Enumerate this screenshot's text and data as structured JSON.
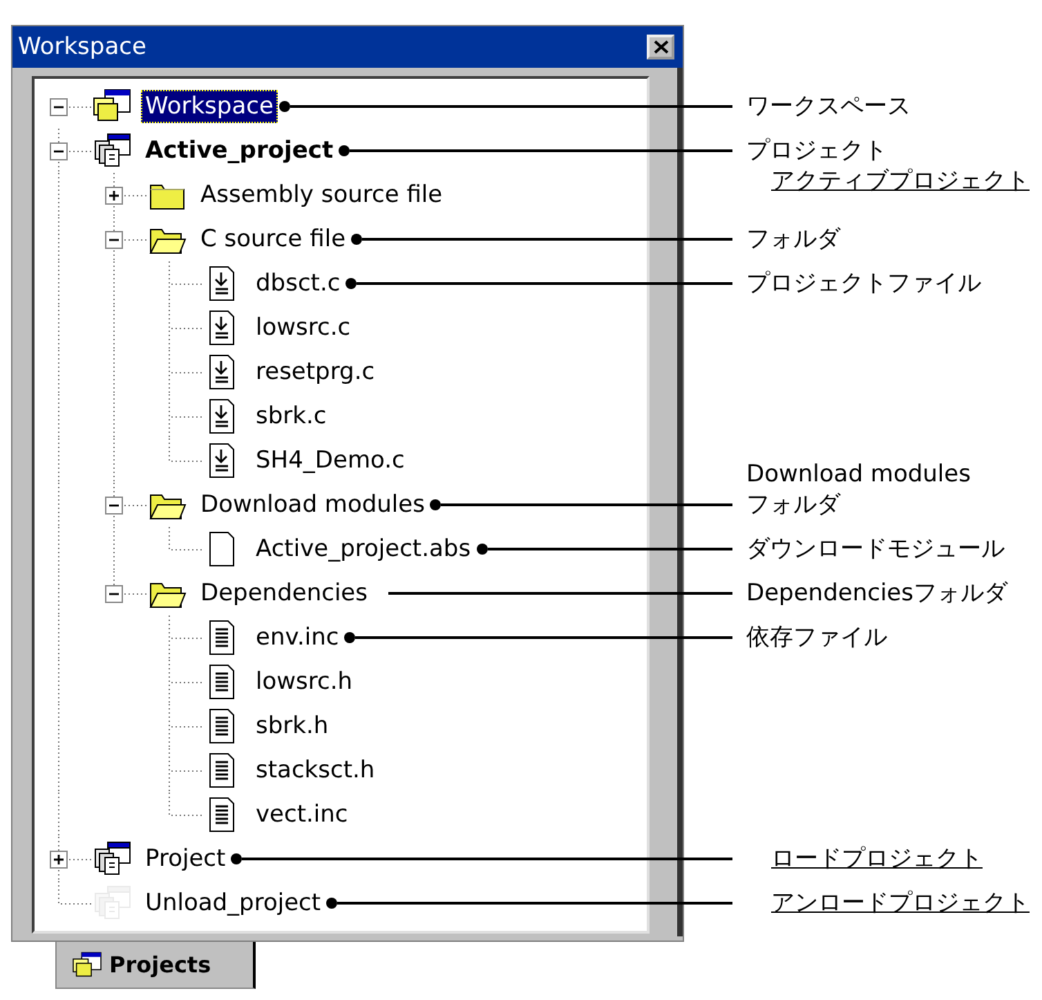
{
  "window": {
    "title": "Workspace"
  },
  "tree": [
    {
      "label": "Workspace",
      "kind": "workspace",
      "selected": true,
      "active": false,
      "disabled": false,
      "expanded": true,
      "callout": {
        "dot": true,
        "lines": [
          {
            "text": "ワークスペース",
            "underlined": false
          }
        ]
      },
      "children": [
        {
          "label": "Active_project",
          "kind": "project",
          "selected": false,
          "active": true,
          "disabled": false,
          "expanded": true,
          "callout": {
            "kind": "label-below",
            "dot": true,
            "lines": [
              {
                "text": "プロジェクト",
                "underlined": false
              },
              {
                "text": "アクティブプロジェクト",
                "underlined": true
              }
            ]
          },
          "children": [
            {
              "label": "Assembly source file",
              "kind": "folder",
              "selected": false,
              "active": false,
              "disabled": false,
              "expanded": false
            },
            {
              "label": "C source file",
              "kind": "folder-open",
              "selected": false,
              "active": false,
              "disabled": false,
              "expanded": true,
              "callout": {
                "dot": true,
                "lines": [
                  {
                    "text": "フォルダ",
                    "underlined": false
                  }
                ]
              },
              "children": [
                {
                  "label": "dbsct.c",
                  "kind": "download-file",
                  "selected": false,
                  "active": false,
                  "disabled": false,
                  "callout": {
                    "dot": true,
                    "lines": [
                      {
                        "text": "プロジェクトファイル",
                        "underlined": false
                      }
                    ]
                  }
                },
                {
                  "label": "lowsrc.c",
                  "kind": "download-file",
                  "selected": false,
                  "active": false,
                  "disabled": false
                },
                {
                  "label": "resetprg.c",
                  "kind": "download-file",
                  "selected": false,
                  "active": false,
                  "disabled": false
                },
                {
                  "label": "sbrk.c",
                  "kind": "download-file",
                  "selected": false,
                  "active": false,
                  "disabled": false
                },
                {
                  "label": "SH4_Demo.c",
                  "kind": "download-file",
                  "selected": false,
                  "active": false,
                  "disabled": false
                }
              ]
            },
            {
              "label": "Download modules",
              "kind": "folder-open",
              "selected": false,
              "active": false,
              "disabled": false,
              "expanded": true,
              "callout": {
                "kind": "label-above",
                "dot": true,
                "lines": [
                  {
                    "text": "Download modules",
                    "underlined": false
                  },
                  {
                    "text": "フォルダ",
                    "underlined": false
                  }
                ]
              },
              "children": [
                {
                  "label": "Active_project.abs",
                  "kind": "blank-file",
                  "selected": false,
                  "active": false,
                  "disabled": false,
                  "callout": {
                    "dot": true,
                    "lines": [
                      {
                        "text": "ダウンロードモジュール",
                        "underlined": false
                      }
                    ]
                  }
                }
              ]
            },
            {
              "label": "Dependencies",
              "kind": "folder-open",
              "selected": false,
              "active": false,
              "disabled": false,
              "expanded": true,
              "callout": {
                "dot": false,
                "lines": [
                  {
                    "text": "Dependenciesフォルダ",
                    "underlined": false
                  }
                ]
              },
              "children": [
                {
                  "label": "env.inc",
                  "kind": "text-file",
                  "selected": false,
                  "active": false,
                  "disabled": false,
                  "callout": {
                    "dot": true,
                    "lines": [
                      {
                        "text": "依存ファイル",
                        "underlined": false
                      }
                    ]
                  }
                },
                {
                  "label": "lowsrc.h",
                  "kind": "text-file",
                  "selected": false,
                  "active": false,
                  "disabled": false
                },
                {
                  "label": "sbrk.h",
                  "kind": "text-file",
                  "selected": false,
                  "active": false,
                  "disabled": false
                },
                {
                  "label": "stacksct.h",
                  "kind": "text-file",
                  "selected": false,
                  "active": false,
                  "disabled": false
                },
                {
                  "label": "vect.inc",
                  "kind": "text-file",
                  "selected": false,
                  "active": false,
                  "disabled": false
                }
              ]
            }
          ]
        },
        {
          "label": "Project",
          "kind": "project",
          "selected": false,
          "active": false,
          "disabled": false,
          "expanded": false,
          "callout": {
            "dot": true,
            "lines": [
              {
                "text": "ロードプロジェクト",
                "underlined": true
              }
            ]
          }
        },
        {
          "label": "Unload_project",
          "kind": "project",
          "selected": false,
          "active": false,
          "disabled": true,
          "callout": {
            "dot": true,
            "lines": [
              {
                "text": "アンロードプロジェクト",
                "underlined": true
              }
            ]
          }
        }
      ]
    }
  ],
  "tabs": [
    {
      "label": "Projects",
      "kind": "workspace",
      "selected": true
    }
  ]
}
